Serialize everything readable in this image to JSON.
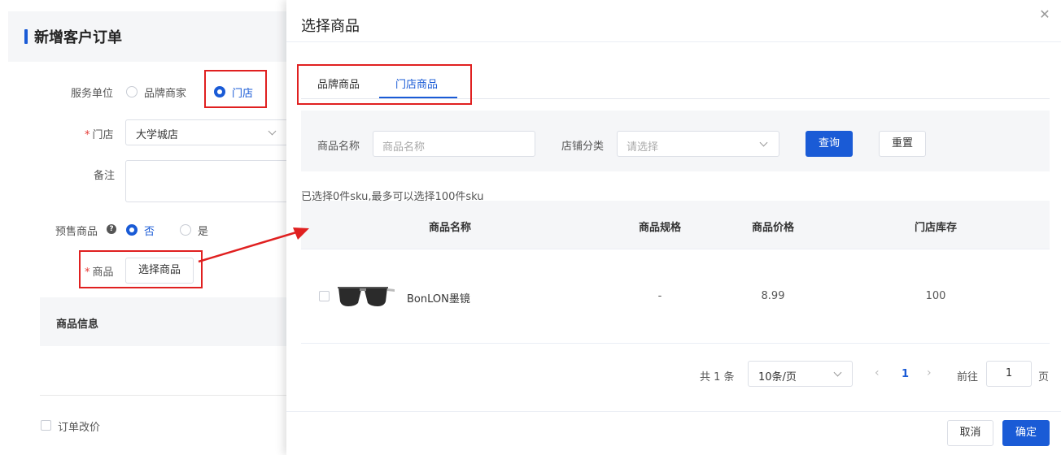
{
  "page": {
    "title": "新增客户订单",
    "service_unit": {
      "label": "服务单位",
      "options": [
        "品牌商家",
        "门店"
      ],
      "selected": "门店"
    },
    "store": {
      "label": "门店",
      "value": "大学城店"
    },
    "remark": {
      "label": "备注",
      "value": ""
    },
    "presale": {
      "label": "预售商品",
      "help_icon": "?",
      "options": [
        "否",
        "是"
      ],
      "selected": "否"
    },
    "product": {
      "label": "商品",
      "button": "选择商品"
    },
    "product_info": {
      "label": "商品信息"
    },
    "order_reprice": {
      "label": "订单改价"
    }
  },
  "drawer": {
    "title": "选择商品",
    "close_symbol": "✕",
    "tabs": [
      {
        "label": "品牌商品"
      },
      {
        "label": "门店商品"
      }
    ],
    "active_tab": "门店商品",
    "filter": {
      "name_label": "商品名称",
      "name_placeholder": "商品名称",
      "category_label": "店铺分类",
      "category_placeholder": "请选择",
      "search_button": "查询",
      "reset_button": "重置"
    },
    "selection_info": "已选择0件sku,最多可以选择100件sku",
    "table": {
      "columns": [
        "商品名称",
        "商品规格",
        "商品价格",
        "门店库存"
      ],
      "rows": [
        {
          "name": "BonLON墨镜",
          "spec": "-",
          "price": "8.99",
          "stock": "100",
          "thumbnail": "sunglasses-image"
        }
      ]
    },
    "pagination": {
      "total": "共 1 条",
      "page_size": "10条/页",
      "prev": "‹",
      "current": "1",
      "next": "›",
      "goto_label": "前往",
      "goto_value": "1",
      "page_unit": "页"
    },
    "footer": {
      "cancel": "取消",
      "confirm": "确定"
    }
  },
  "colors": {
    "primary": "#1a5bd6",
    "annotation": "#e02020",
    "required": "#e53935"
  }
}
